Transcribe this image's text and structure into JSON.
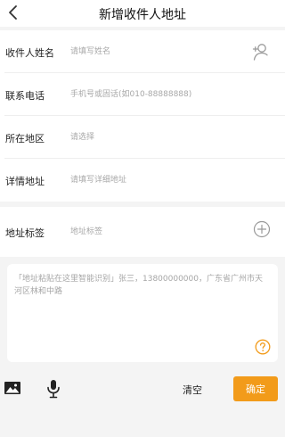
{
  "header": {
    "title": "新增收件人地址",
    "back_icon": "chevron-left-icon"
  },
  "form": {
    "name": {
      "label": "收件人姓名",
      "placeholder": "请填写姓名",
      "icon": "add-contact-icon"
    },
    "phone": {
      "label": "联系电话",
      "placeholder": "手机号或固话(如010-88888888)"
    },
    "region": {
      "label": "所在地区",
      "placeholder": "请选择"
    },
    "detail": {
      "label": "详情地址",
      "placeholder": "请填写详细地址"
    }
  },
  "tag": {
    "label": "地址标签",
    "placeholder": "地址标签",
    "icon": "plus-circle-icon"
  },
  "paste": {
    "placeholder": "「地址粘贴在这里智能识别」张三，13800000000，广东省广州市天河区林和中路",
    "help_icon": "question-circle-icon"
  },
  "toolbar": {
    "image_icon": "image-icon",
    "mic_icon": "microphone-icon",
    "clear_label": "清空",
    "confirm_label": "确定"
  },
  "colors": {
    "accent": "#f29b1a",
    "background": "#f4f4f4",
    "card": "#ffffff",
    "placeholder": "#a8a8a8"
  }
}
